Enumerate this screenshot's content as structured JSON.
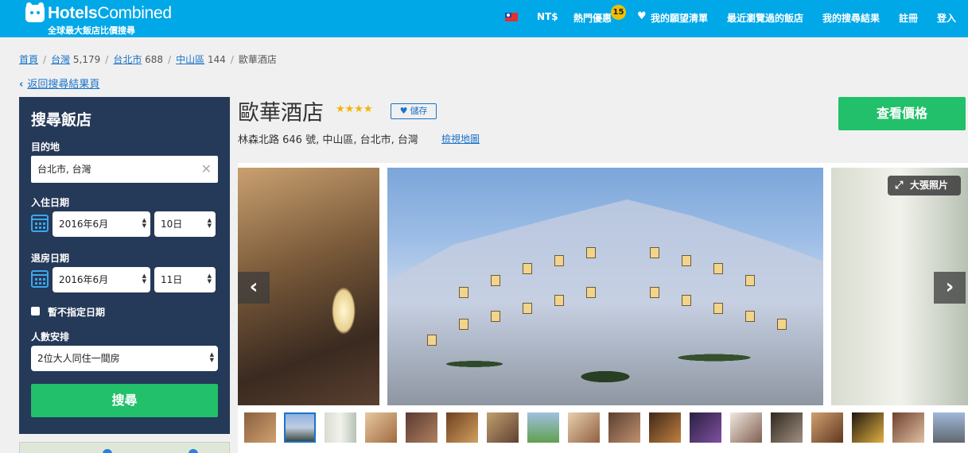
{
  "header": {
    "logo_name_bold": "Hotels",
    "logo_name_light": "Combined",
    "logo_tagline": "全球最大飯店比價搜尋",
    "currency": "NT$",
    "hot_deals": "熱門優惠",
    "hot_deals_count": "15",
    "wishlist": "我的願望清單",
    "recent": "最近瀏覽過的飯店",
    "my_results": "我的搜尋結果",
    "register": "註冊",
    "login": "登入",
    "colors": {
      "bar": "#00a8e8",
      "badge": "#f0c000"
    }
  },
  "breadcrumb": {
    "home": "首頁",
    "country": "台灣",
    "country_count": "5,179",
    "city": "台北市",
    "city_count": "688",
    "district": "中山區",
    "district_count": "144",
    "current": "歐華酒店",
    "separator": "/"
  },
  "back_link": "返回搜尋結果頁",
  "search": {
    "title": "搜尋飯店",
    "destination_label": "目的地",
    "destination_value": "台北市, 台灣",
    "checkin_label": "入住日期",
    "checkin_month": "2016年6月",
    "checkin_day": "10日",
    "checkout_label": "退房日期",
    "checkout_month": "2016年6月",
    "checkout_day": "11日",
    "no_dates_label": "暫不指定日期",
    "guests_label": "人數安排",
    "guests_value": "2位大人同住一間房",
    "button": "搜尋",
    "colors": {
      "panel": "#253958",
      "button": "#22c06a",
      "calendar": "#3aa7ec"
    }
  },
  "hotel": {
    "name": "歐華酒店",
    "stars": "★★★★",
    "save_label": "儲存",
    "address": "林森北路 646 號, 中山區, 台北市, 台灣",
    "map_link": "檢視地圖",
    "price_button": "查看價格",
    "colors": {
      "price_button": "#22c06a",
      "star": "#f5b400",
      "link": "#1a73c9"
    }
  },
  "gallery": {
    "big_photo_label": "大張照片",
    "prev_icon": "chevron-left-icon",
    "next_icon": "chevron-right-icon",
    "thumbnail_count": 18,
    "active_thumbnail": 2
  }
}
